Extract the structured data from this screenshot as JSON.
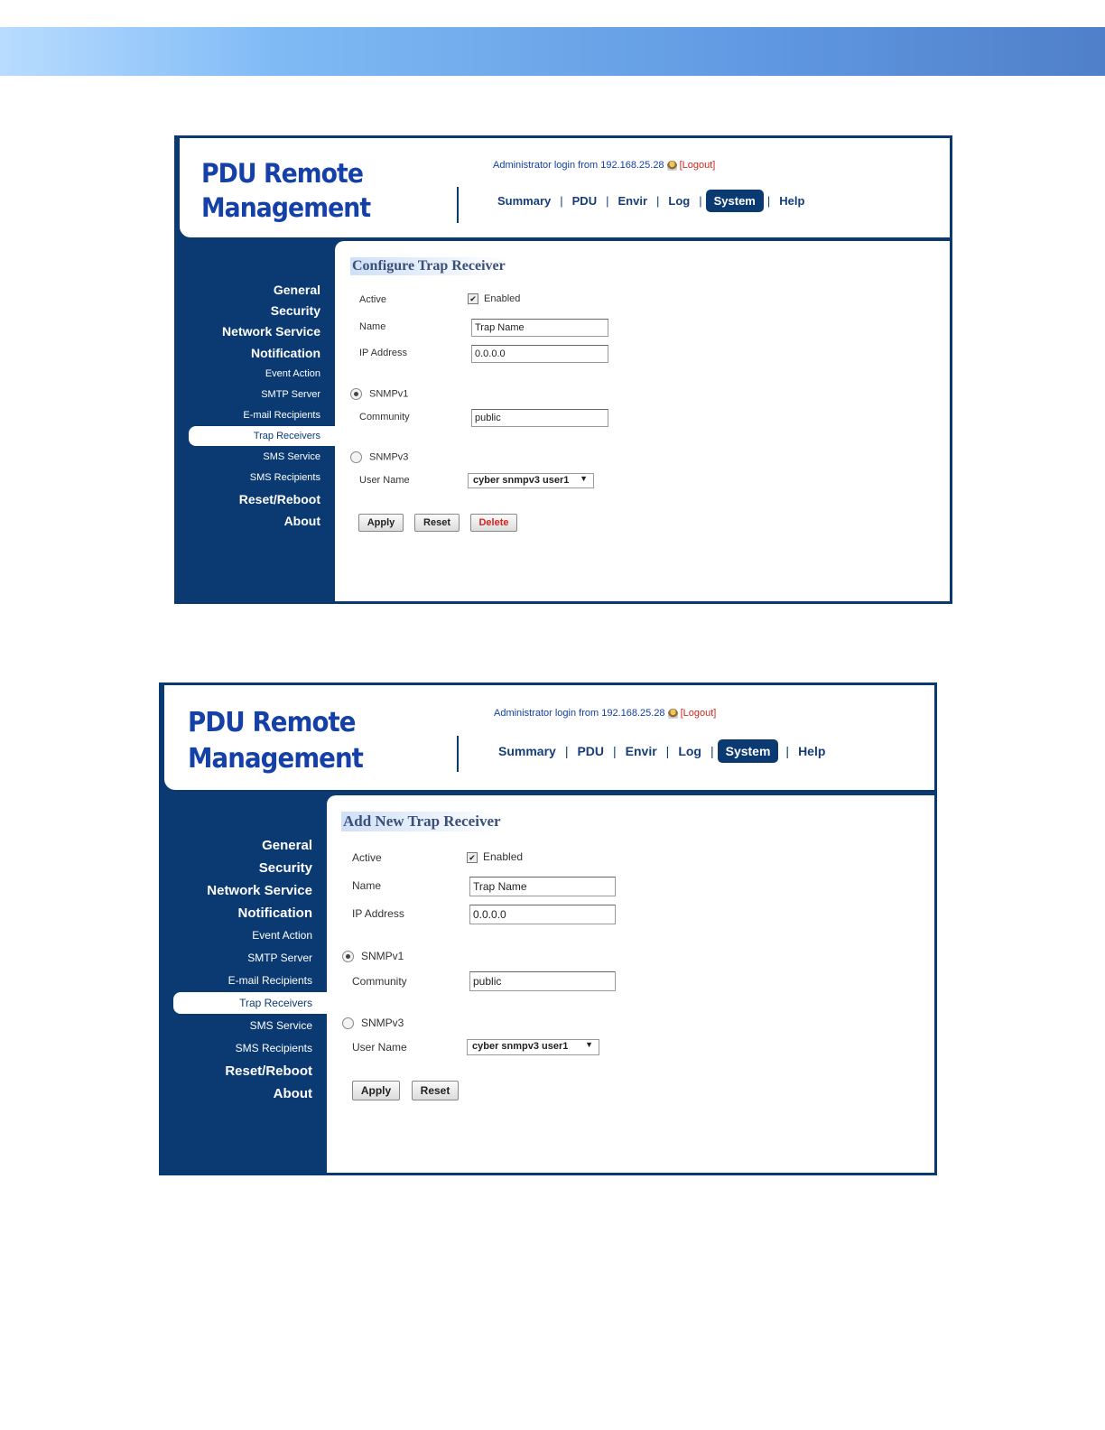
{
  "header": {
    "logo_line1": "PDU Remote",
    "logo_line2": "Management",
    "login_text": "Administrator login from 192.168.25.28",
    "logout_label": "[Logout]"
  },
  "nav": {
    "summary": "Summary",
    "pdu": "PDU",
    "envir": "Envir",
    "log": "Log",
    "system": "System",
    "help": "Help",
    "separator": "|"
  },
  "sidebar": {
    "general": "General",
    "security": "Security",
    "network_service": "Network Service",
    "notification": "Notification",
    "event_action": "Event Action",
    "smtp_server": "SMTP Server",
    "email_recipients": "E-mail Recipients",
    "trap_receivers": "Trap Receivers",
    "sms_service": "SMS Service",
    "sms_recipients": "SMS Recipients",
    "reset_reboot": "Reset/Reboot",
    "about": "About"
  },
  "form_labels": {
    "active": "Active",
    "enabled": "Enabled",
    "name": "Name",
    "ip_address": "IP Address",
    "snmpv1": "SNMPv1",
    "community": "Community",
    "snmpv3": "SNMPv3",
    "user_name": "User Name"
  },
  "configure": {
    "title": "Configure Trap Receiver",
    "name_value": "Trap Name",
    "ip_value": "0.0.0.0",
    "community_value": "public",
    "user_select": "cyber snmpv3 user1",
    "apply": "Apply",
    "reset": "Reset",
    "delete": "Delete"
  },
  "add_new": {
    "title": "Add New Trap Receiver",
    "name_value": "Trap Name",
    "ip_value": "0.0.0.0",
    "community_value": "public",
    "user_select": "cyber snmpv3 user1",
    "apply": "Apply",
    "reset": "Reset"
  },
  "icons": {
    "checkbox_check": "✔",
    "dropdown_arrow": "▼",
    "user_icon": "user-lock-icon"
  },
  "colors": {
    "navy": "#0b3a73",
    "logo_blue": "#1440a8",
    "logout_red": "#d0261d"
  }
}
